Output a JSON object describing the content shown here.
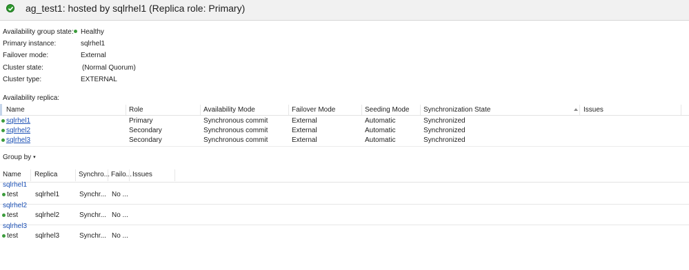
{
  "header": {
    "title": "ag_test1: hosted by sqlrhel1 (Replica role: Primary)",
    "icon": "check-circle-icon",
    "icon_color": "#2e9a2e"
  },
  "properties": [
    {
      "label": "Availability group state:",
      "value": "Healthy",
      "status_color": "#3c9c3c"
    },
    {
      "label": "Primary instance:",
      "value": "sqlrhel1"
    },
    {
      "label": "Failover mode:",
      "value": "External"
    },
    {
      "label": "Cluster state:",
      "value": "(Normal Quorum)"
    },
    {
      "label": "Cluster type:",
      "value": "EXTERNAL"
    }
  ],
  "replica_section": {
    "label": "Availability replica:",
    "columns": [
      "Name",
      "Role",
      "Availability Mode",
      "Failover Mode",
      "Seeding Mode",
      "Synchronization State",
      "Issues"
    ],
    "rows": [
      {
        "name": "sqlrhel1",
        "role": "Primary",
        "availability_mode": "Synchronous commit",
        "failover_mode": "External",
        "seeding_mode": "Automatic",
        "sync_state": "Synchronized",
        "issues": ""
      },
      {
        "name": "sqlrhel2",
        "role": "Secondary",
        "availability_mode": "Synchronous commit",
        "failover_mode": "External",
        "seeding_mode": "Automatic",
        "sync_state": "Synchronized",
        "issues": ""
      },
      {
        "name": "sqlrhel3",
        "role": "Secondary",
        "availability_mode": "Synchronous commit",
        "failover_mode": "External",
        "seeding_mode": "Automatic",
        "sync_state": "Synchronized",
        "issues": ""
      }
    ]
  },
  "group_by": {
    "label": "Group by",
    "caret": "▾"
  },
  "database_grid": {
    "columns": [
      "Name",
      "Replica",
      "Synchro...",
      "Failo...",
      "Issues"
    ],
    "groups": [
      {
        "title": "sqlrhel1",
        "rows": [
          {
            "name": "test",
            "replica": "sqlrhel1",
            "sync": "Synchr...",
            "failover": "No ...",
            "issues": ""
          }
        ]
      },
      {
        "title": "sqlrhel2",
        "rows": [
          {
            "name": "test",
            "replica": "sqlrhel2",
            "sync": "Synchr...",
            "failover": "No ...",
            "issues": ""
          }
        ]
      },
      {
        "title": "sqlrhel3",
        "rows": [
          {
            "name": "test",
            "replica": "sqlrhel3",
            "sync": "Synchr...",
            "failover": "No ...",
            "issues": ""
          }
        ]
      }
    ]
  }
}
